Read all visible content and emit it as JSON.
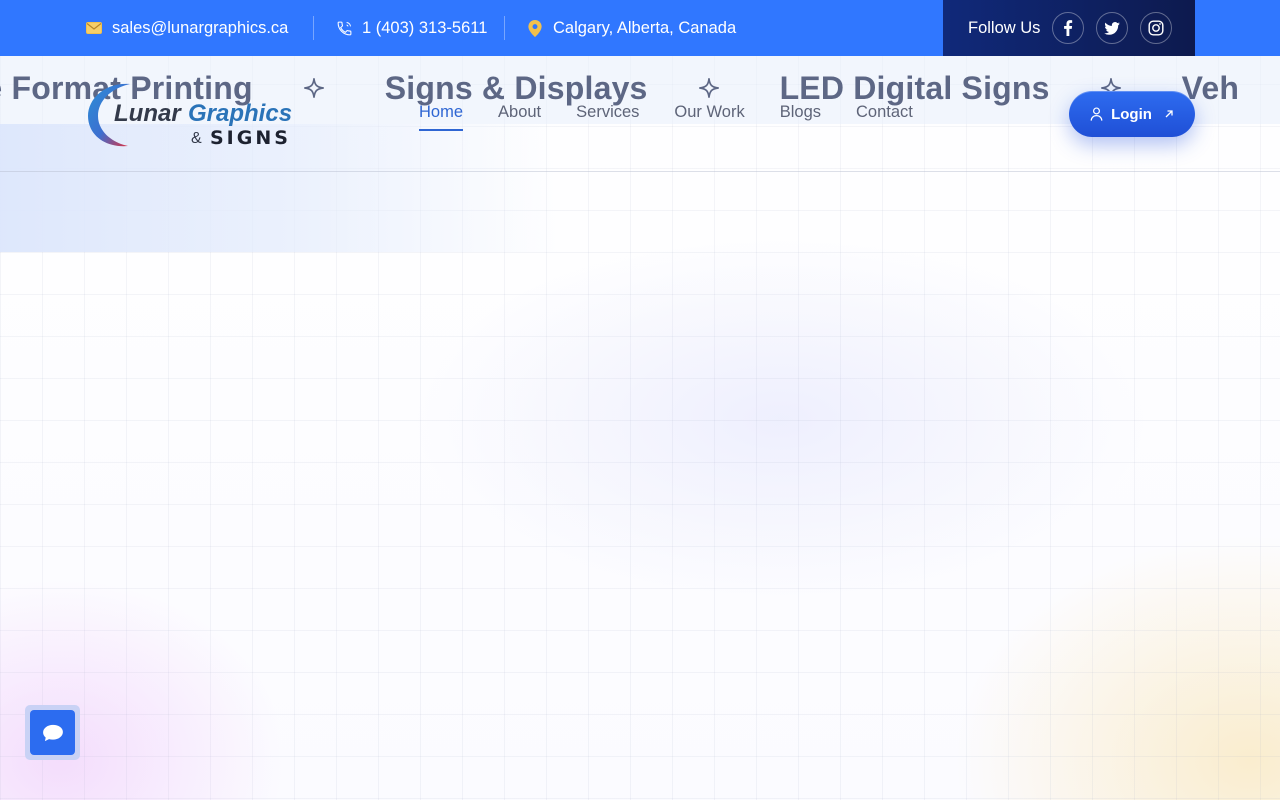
{
  "topbar": {
    "email": "sales@lunargraphics.ca",
    "phone": "1 (403) 313-5611",
    "location": "Calgary, Alberta, Canada",
    "follow_label": "Follow Us",
    "social_icons": [
      "facebook-icon",
      "twitter-icon",
      "instagram-icon"
    ]
  },
  "marquee": {
    "items": [
      "rge Format Printing",
      "Signs & Displays",
      "LED Digital Signs",
      "Veh"
    ]
  },
  "logo": {
    "word1": "Lunar",
    "word2": "Graphics",
    "amp": "&",
    "word3": "SIGNS"
  },
  "nav": {
    "items": [
      "Home",
      "About",
      "Services",
      "Our Work",
      "Blogs",
      "Contact"
    ],
    "active": "Home"
  },
  "login": {
    "label": "Login"
  },
  "colors": {
    "topbar": "#3077ff",
    "follow_bg": "#10297a",
    "accent": "#2f66d3",
    "envelope": "#f2c04c",
    "pin": "#f2c04c"
  }
}
